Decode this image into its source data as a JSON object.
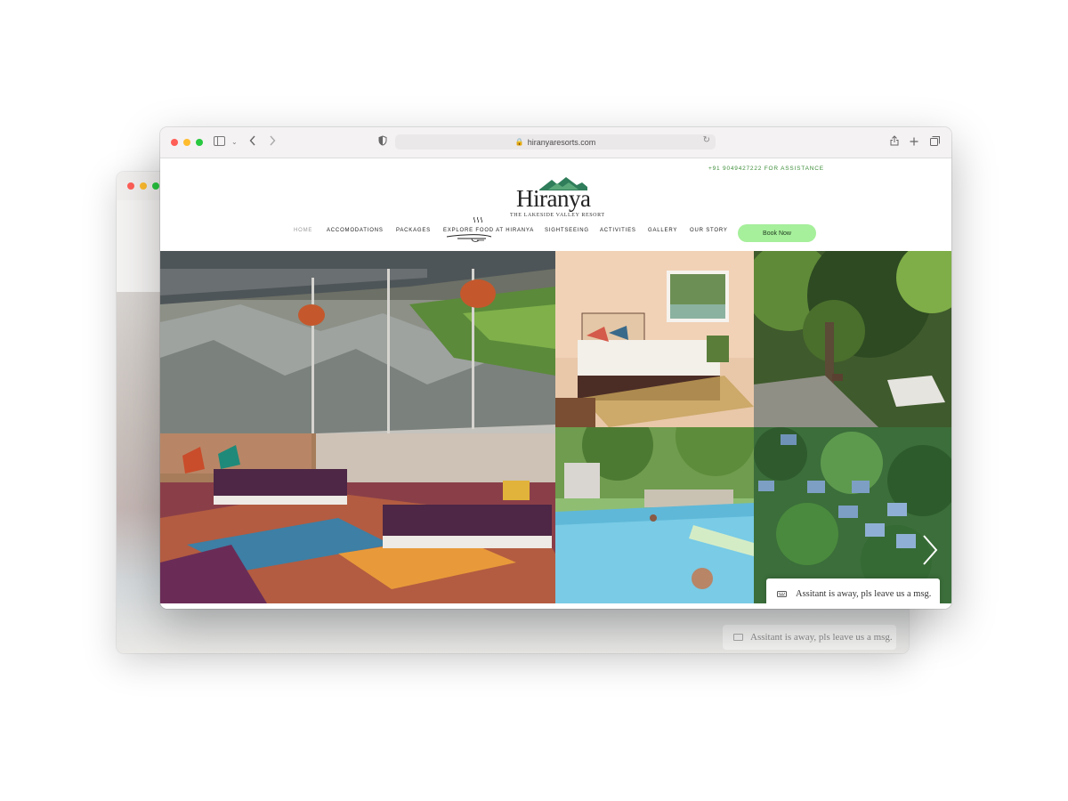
{
  "browser": {
    "url": "hiranyaresorts.com",
    "traffic_colors": [
      "#ff5f57",
      "#febc2e",
      "#28c840"
    ]
  },
  "site": {
    "phone": "+91 9049427222 FOR ASSISTANCE",
    "logo": {
      "name": "Hiranya",
      "tagline": "THE LAKESIDE VALLEY RESORT"
    },
    "nav": [
      {
        "label": "HOME",
        "active": true
      },
      {
        "label": "ACCOMODATIONS"
      },
      {
        "label": "PACKAGES"
      },
      {
        "label": "EXPLORE FOOD AT HIRANYA"
      },
      {
        "label": "SIGHTSEEING"
      },
      {
        "label": "ACTIVITIES"
      },
      {
        "label": "GALLERY"
      },
      {
        "label": "OUR STORY"
      }
    ],
    "book_button": "Book Now",
    "accent_color": "#a6ef9b",
    "phone_color": "#3e8e3a"
  },
  "gallery": {
    "photos": [
      {
        "subject": "covered dining terrace with rocks and lanterns"
      },
      {
        "subject": "bedroom"
      },
      {
        "subject": "tree-lined driveway"
      },
      {
        "subject": "swimming pool"
      },
      {
        "subject": "aerial view of cottages"
      }
    ],
    "next_icon": "chevron-right-icon"
  },
  "chat": {
    "message": "Assitant is away, pls leave us a msg.",
    "icon": "keyboard-icon"
  }
}
